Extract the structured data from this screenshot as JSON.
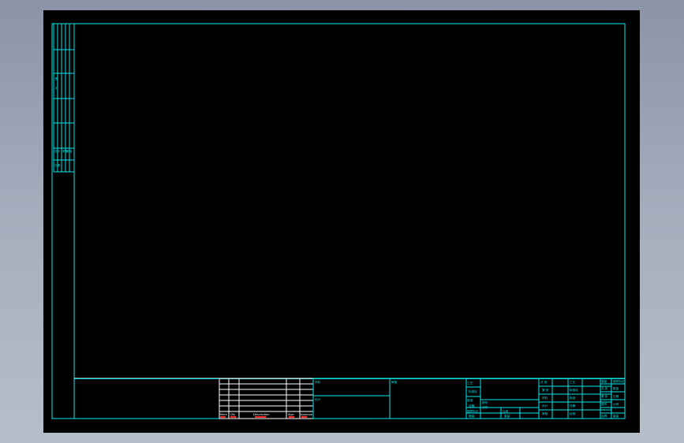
{
  "colors": {
    "background": "#a4aebd",
    "canvas": "#000000",
    "frame": "#00e8ee",
    "table": "#ffffff",
    "marks": "#ff2a2a"
  },
  "revision_table": {
    "headers": [
      "Mark",
      "Qty",
      "Description",
      "Sign",
      "Approve"
    ]
  },
  "left_strip": {
    "labels": [
      "签",
      "字",
      "设计",
      "审核",
      "批准",
      "日期"
    ]
  },
  "title_block": {
    "cells": [
      "材料",
      "设计",
      "审核",
      "工艺",
      "标准化",
      "批准",
      "日期",
      "比例",
      "重量",
      "共 张",
      "第 张",
      "图号",
      "名称",
      "图样标记",
      "数量"
    ]
  }
}
